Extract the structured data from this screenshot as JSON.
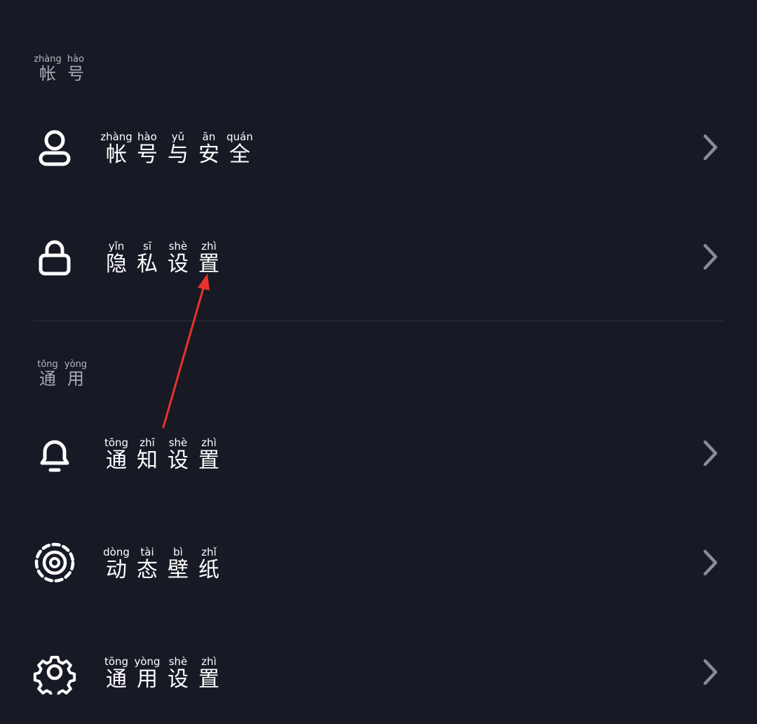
{
  "sections": [
    {
      "header": [
        {
          "py": "zhàng",
          "hz": "帐"
        },
        {
          "py": "hào",
          "hz": "号"
        }
      ]
    },
    {
      "header": [
        {
          "py": "tōng",
          "hz": "通"
        },
        {
          "py": "yòng",
          "hz": "用"
        }
      ]
    }
  ],
  "rows": {
    "account": {
      "icon": "person-icon",
      "label": [
        {
          "py": "zhàng",
          "hz": "帐"
        },
        {
          "py": "hào",
          "hz": "号"
        },
        {
          "py": "yǔ",
          "hz": "与"
        },
        {
          "py": "ān",
          "hz": "安"
        },
        {
          "py": "quán",
          "hz": "全"
        }
      ]
    },
    "privacy": {
      "icon": "lock-icon",
      "label": [
        {
          "py": "yǐn",
          "hz": "隐"
        },
        {
          "py": "sī",
          "hz": "私"
        },
        {
          "py": "shè",
          "hz": "设"
        },
        {
          "py": "zhì",
          "hz": "置"
        }
      ]
    },
    "notifications": {
      "icon": "bell-icon",
      "label": [
        {
          "py": "tōng",
          "hz": "通"
        },
        {
          "py": "zhī",
          "hz": "知"
        },
        {
          "py": "shè",
          "hz": "设"
        },
        {
          "py": "zhì",
          "hz": "置"
        }
      ]
    },
    "wallpaper": {
      "icon": "live-wallpaper-icon",
      "label": [
        {
          "py": "dòng",
          "hz": "动"
        },
        {
          "py": "tài",
          "hz": "态"
        },
        {
          "py": "bì",
          "hz": "壁"
        },
        {
          "py": "zhǐ",
          "hz": "纸"
        }
      ]
    },
    "general": {
      "icon": "gear-icon",
      "label": [
        {
          "py": "tōng",
          "hz": "通"
        },
        {
          "py": "yòng",
          "hz": "用"
        },
        {
          "py": "shè",
          "hz": "设"
        },
        {
          "py": "zhì",
          "hz": "置"
        }
      ]
    }
  },
  "colors": {
    "background": "#171925",
    "icon": "#ffffff",
    "chevron": "#8a8b94",
    "divider": "#2d2f3b",
    "annotation_arrow": "#e8322b"
  }
}
